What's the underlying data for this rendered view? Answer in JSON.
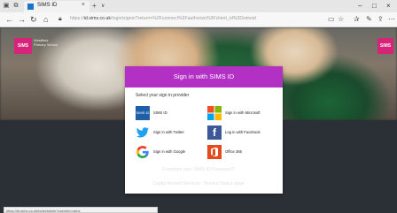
{
  "browser": {
    "tab_title": "SIMS ID",
    "tab_close": "×",
    "new_tab": "+",
    "tab_menu": "∨",
    "url_prefix": "https://",
    "url_host": "id.sims.co.uk",
    "url_rest": "/login/signin?return=%2Fconnect%2Fauthorize%3Fclient_id%3Dsimsid",
    "status_text": "https://id.sims.co.uk/login/signin?provider=sims"
  },
  "brand": {
    "logo_text": "SIMS",
    "school_text": "Westfield Primary School",
    "logo_right_text": "SIMS"
  },
  "card": {
    "title": "Sign in with SIMS ID",
    "subtitle": "Select your sign in provider",
    "providers": [
      {
        "label": "SIMS ID",
        "icon": "sims-id-icon",
        "icon_text": "SIMS ID"
      },
      {
        "label": "Sign in with Microsoft",
        "icon": "microsoft-icon"
      },
      {
        "label": "Sign in with Twitter",
        "icon": "twitter-icon"
      },
      {
        "label": "Log in with Facebook",
        "icon": "facebook-icon",
        "icon_text": "f"
      },
      {
        "label": "Sign in with Google",
        "icon": "google-icon"
      },
      {
        "label": "Office 365",
        "icon": "office-365-icon"
      }
    ]
  },
  "footer": {
    "forgot": "Forgotten your SIMS ID Password?",
    "services": "Capita Hosted Services: Service Status page"
  },
  "colors": {
    "header": "#b230c4",
    "page_bottom": "#2b2f36",
    "sims_pink": "#d6247a"
  }
}
